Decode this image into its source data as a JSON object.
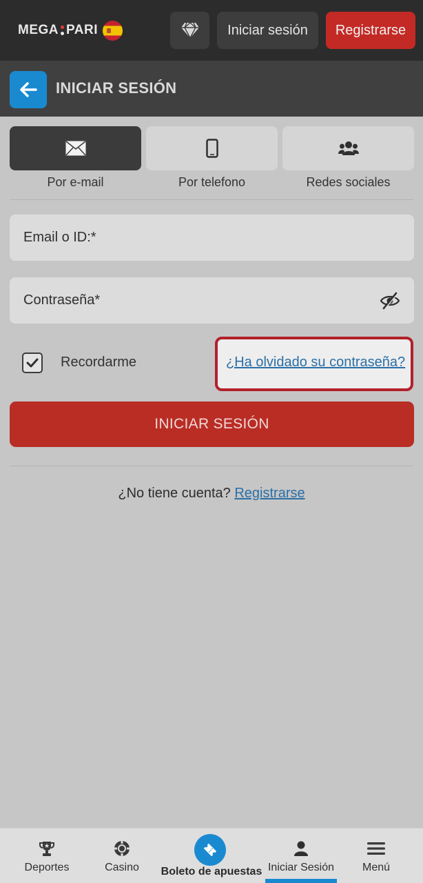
{
  "header": {
    "logo_left": "MEGA",
    "logo_right": "PARI",
    "flag_icon": "spain-flag-icon",
    "gem_icon": "diamond-icon",
    "login_label": "Iniciar sesión",
    "register_label": "Registrarse"
  },
  "titlebar": {
    "back_icon": "arrow-left-icon",
    "title": "INICIAR SESIÓN"
  },
  "methods": [
    {
      "label": "Por e-mail",
      "icon": "envelope-icon",
      "active": true
    },
    {
      "label": "Por telefono",
      "icon": "phone-icon",
      "active": false
    },
    {
      "label": "Redes sociales",
      "icon": "users-icon",
      "active": false
    }
  ],
  "form": {
    "email_placeholder": "Email o ID:*",
    "email_value": "",
    "password_placeholder": "Contraseña*",
    "password_value": "",
    "eye_icon": "eye-slash-icon",
    "remember_label": "Recordarme",
    "remember_checked": true,
    "forgot_label": "¿Ha olvidado su contraseña?",
    "submit_label": "INICIAR SESIÓN"
  },
  "signup": {
    "prompt": "¿No tiene cuenta?",
    "link": "Registrarse"
  },
  "bottom_nav": [
    {
      "label": "Deportes",
      "icon": "trophy-icon"
    },
    {
      "label": "Casino",
      "icon": "casino-chip-icon"
    },
    {
      "label": "Boleto de apuestas",
      "icon": "ticket-icon"
    },
    {
      "label": "Iniciar Sesión",
      "icon": "user-icon",
      "active": true
    },
    {
      "label": "Menú",
      "icon": "hamburger-icon"
    }
  ],
  "colors": {
    "accent": "#1a8ad0",
    "brand_red": "#c42a25",
    "highlight_border": "#b3202a"
  }
}
